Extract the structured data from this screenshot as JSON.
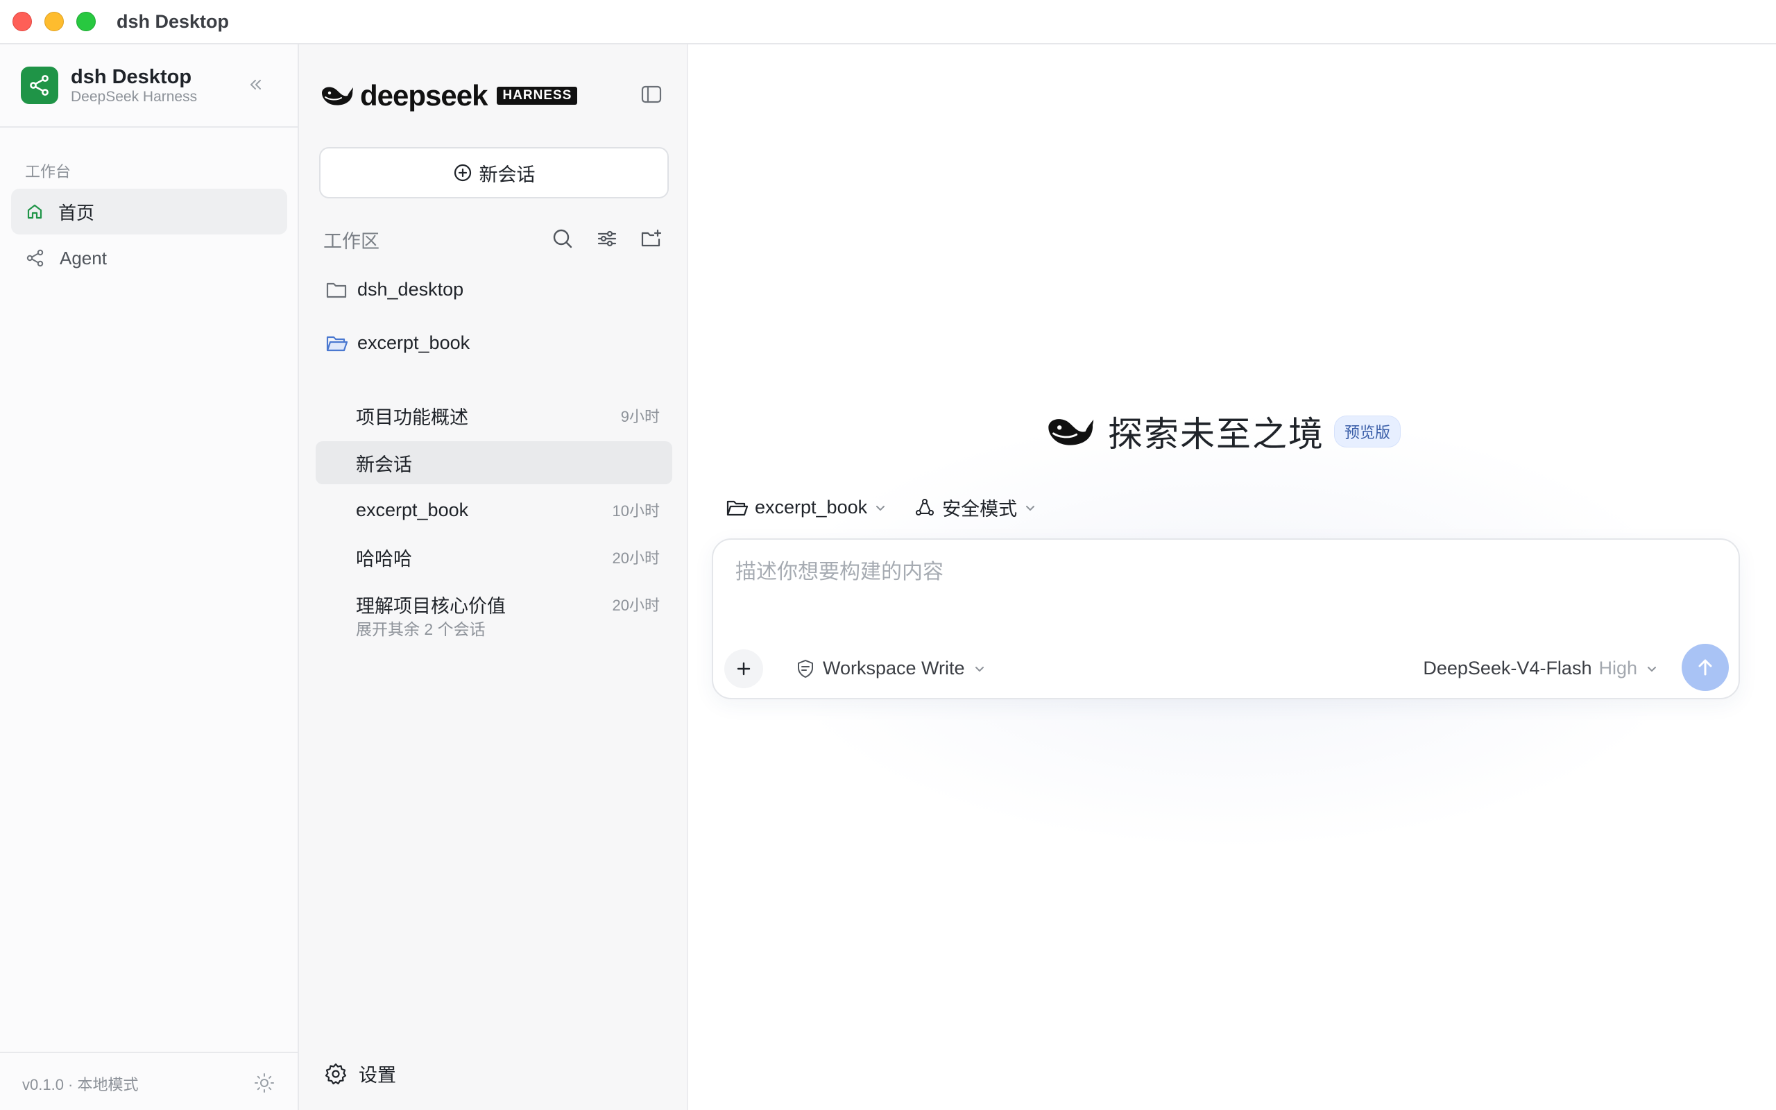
{
  "window": {
    "title": "dsh Desktop"
  },
  "sidebar": {
    "brand_name": "dsh Desktop",
    "brand_sub": "DeepSeek Harness",
    "section_label": "工作台",
    "items": [
      {
        "label": "首页",
        "icon": "home-icon",
        "active": true
      },
      {
        "label": "Agent",
        "icon": "agent-icon",
        "active": false
      }
    ],
    "footer_version": "v0.1.0 · 本地模式"
  },
  "middle": {
    "logo_word": "deepseek",
    "logo_badge": "HARNESS",
    "new_chat_label": "新会话",
    "workspace_label": "工作区",
    "folders": [
      {
        "name": "dsh_desktop",
        "open": false
      },
      {
        "name": "excerpt_book",
        "open": true
      }
    ],
    "chats": [
      {
        "title": "项目功能概述",
        "time": "9小时"
      },
      {
        "title": "新会话",
        "time": ""
      },
      {
        "title": "excerpt_book",
        "time": "10小时"
      },
      {
        "title": "哈哈哈",
        "time": "20小时"
      },
      {
        "title": "理解项目核心价值",
        "time": "20小时"
      }
    ],
    "expand_label": "展开其余 2 个会话",
    "settings_label": "设置"
  },
  "main": {
    "hero_title": "探索未至之境",
    "preview_badge": "预览版",
    "context_folder": "excerpt_book",
    "context_mode": "安全模式",
    "composer_placeholder": "描述你想要构建的内容",
    "permission_label": "Workspace Write",
    "model_name": "DeepSeek-V4-Flash",
    "model_level": "High"
  },
  "colors": {
    "brand_green": "#1f9447",
    "send_button": "#a9c3f5",
    "folder_open_blue": "#4a78d0",
    "preview_badge_bg": "#e7efff"
  }
}
